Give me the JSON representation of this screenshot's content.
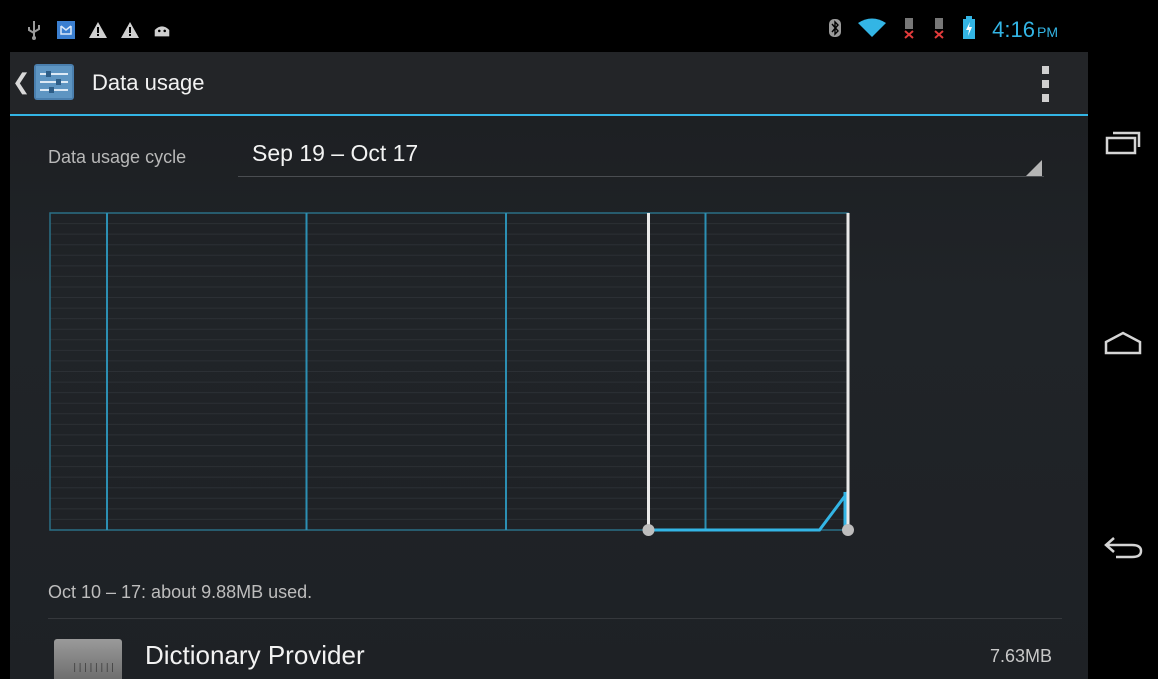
{
  "status_bar": {
    "time": "4:16",
    "ampm": "PM",
    "left_icons": [
      "usb-icon",
      "shield-notification-icon",
      "warning-icon",
      "warning-icon",
      "android-icon"
    ],
    "right_icons": [
      "bluetooth-icon",
      "wifi-icon",
      "sim-missing-icon",
      "sim-missing-icon",
      "battery-charging-icon"
    ]
  },
  "action_bar": {
    "title": "Data usage"
  },
  "cycle": {
    "label": "Data usage cycle",
    "value": "Sep 19 – Oct 17"
  },
  "summary": "Oct 10 – 17: about 9.88MB used.",
  "apps": [
    {
      "name": "Dictionary Provider",
      "size": "7.63MB"
    }
  ],
  "colors": {
    "accent": "#33b5e5",
    "background": "#1e2125"
  },
  "chart_data": {
    "type": "area",
    "x_range": [
      "Sep 19",
      "Oct 17"
    ],
    "selected_range": [
      "Oct 10",
      "Oct 17"
    ],
    "series": [
      {
        "values": [
          0,
          0,
          0,
          0,
          0,
          0,
          0,
          0,
          0,
          0,
          0,
          0,
          0,
          0,
          0,
          0,
          0,
          0,
          0,
          0,
          0,
          0,
          0,
          0,
          0,
          0,
          0,
          0,
          0.12
        ]
      }
    ],
    "grid": true
  }
}
